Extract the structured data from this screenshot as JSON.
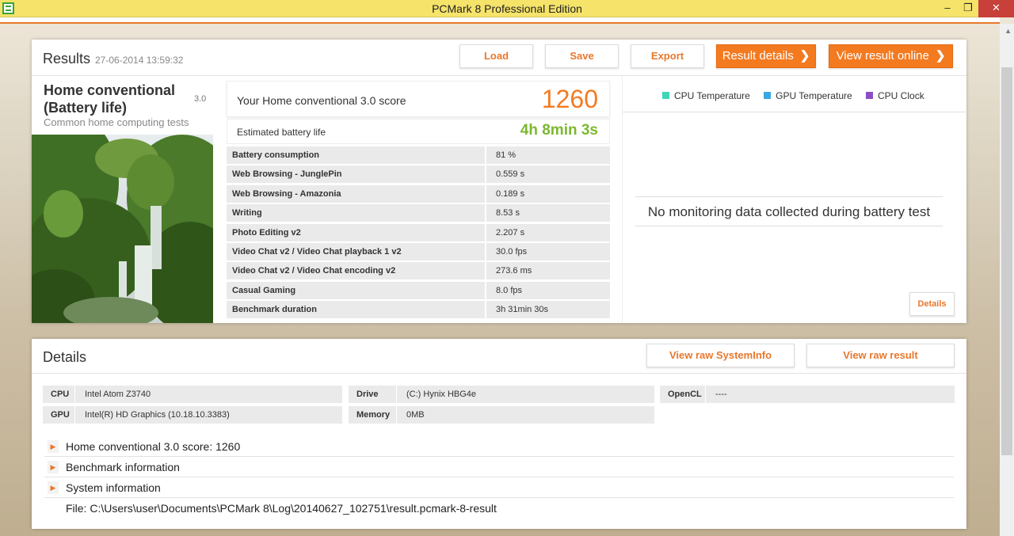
{
  "window": {
    "title": "PCMark 8 Professional Edition",
    "minimize": "–",
    "maximize": "❐",
    "close": "✕"
  },
  "results": {
    "title": "Results",
    "timestamp": "27-06-2014 13:59:32",
    "buttons": {
      "load": "Load",
      "save": "Save",
      "export": "Export",
      "result_details": "Result details",
      "view_online": "View result online"
    },
    "test": {
      "name": "Home conventional (Battery life)",
      "version": "3.0",
      "description": "Common home computing tests"
    },
    "score_label": "Your Home conventional 3.0 score",
    "score_value": "1260",
    "battery_label": "Estimated battery life",
    "battery_value": "4h 8min 3s",
    "subscores": [
      {
        "name": "Battery consumption",
        "value": "81 %"
      },
      {
        "name": "Web Browsing - JunglePin",
        "value": "0.559 s"
      },
      {
        "name": "Web Browsing - Amazonia",
        "value": "0.189 s"
      },
      {
        "name": "Writing",
        "value": "8.53 s"
      },
      {
        "name": "Photo Editing v2",
        "value": "2.207 s"
      },
      {
        "name": "Video Chat v2 / Video Chat playback 1 v2",
        "value": "30.0 fps"
      },
      {
        "name": "Video Chat v2 / Video Chat encoding v2",
        "value": "273.6 ms"
      },
      {
        "name": "Casual Gaming",
        "value": "8.0 fps"
      },
      {
        "name": "Benchmark duration",
        "value": "3h 31min 30s"
      }
    ],
    "monitor": {
      "legend": [
        {
          "label": "CPU Temperature",
          "color": "#3dd6b8"
        },
        {
          "label": "GPU Temperature",
          "color": "#3aa8e0"
        },
        {
          "label": "CPU Clock",
          "color": "#8a4fc8"
        }
      ],
      "message": "No monitoring data collected during battery test",
      "details_button": "Details"
    }
  },
  "details": {
    "title": "Details",
    "view_raw_systeminfo": "View raw SystemInfo",
    "view_raw_result": "View raw result",
    "info": {
      "cpu_label": "CPU",
      "cpu_value": "Intel Atom Z3740",
      "gpu_label": "GPU",
      "gpu_value": "Intel(R) HD Graphics (10.18.10.3383)",
      "drive_label": "Drive",
      "drive_value": "(C:) Hynix HBG4e",
      "memory_label": "Memory",
      "memory_value": "0MB",
      "opencl_label": "OpenCL",
      "opencl_value": "----"
    },
    "expanders": [
      "Home conventional 3.0 score: 1260",
      "Benchmark information",
      "System information"
    ],
    "file": "File: C:\\Users\\user\\Documents\\PCMark 8\\Log\\20140627_102751\\result.pcmark-8-result"
  }
}
